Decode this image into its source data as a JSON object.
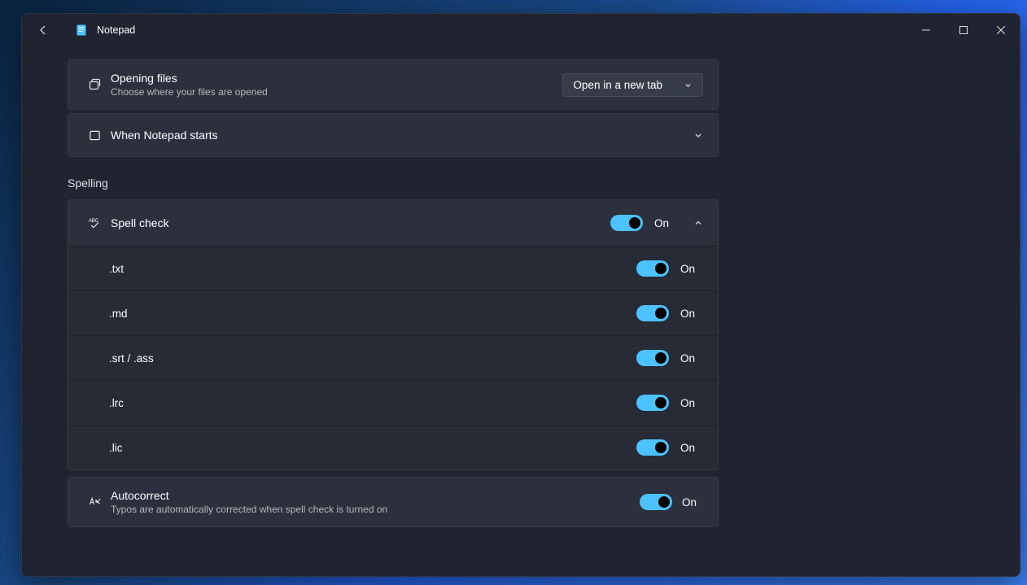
{
  "app": {
    "title": "Notepad"
  },
  "opening_files": {
    "title": "Opening files",
    "subtitle": "Choose where your files are opened",
    "selected": "Open in a new tab"
  },
  "when_starts": {
    "title": "When Notepad starts"
  },
  "spelling_section": "Spelling",
  "spellcheck": {
    "title": "Spell check",
    "state": "On",
    "items": [
      {
        "label": ".txt",
        "state": "On"
      },
      {
        "label": ".md",
        "state": "On"
      },
      {
        "label": ".srt / .ass",
        "state": "On"
      },
      {
        "label": ".lrc",
        "state": "On"
      },
      {
        "label": ".lic",
        "state": "On"
      }
    ]
  },
  "autocorrect": {
    "title": "Autocorrect",
    "subtitle": "Typos are automatically corrected when spell check is turned on",
    "state": "On"
  }
}
